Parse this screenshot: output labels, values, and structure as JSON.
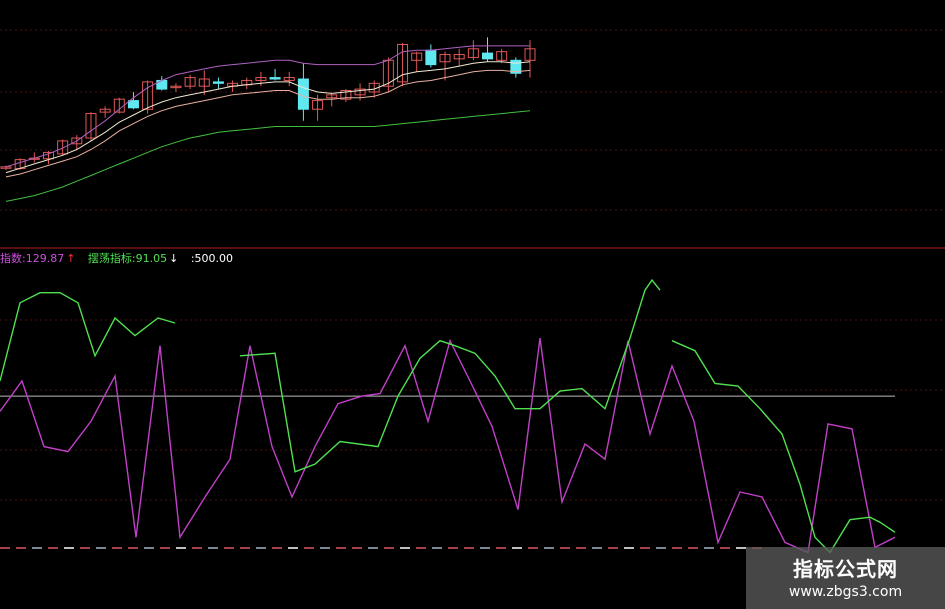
{
  "chart_data": [
    {
      "type": "candlestick",
      "title": "",
      "candles": [
        {
          "o": 8.5,
          "h": 9.4,
          "l": 7.8,
          "c": 9.0
        },
        {
          "o": 8.4,
          "h": 12.0,
          "l": 8.0,
          "c": 11.5
        },
        {
          "o": 11.6,
          "h": 14.0,
          "l": 10.5,
          "c": 12.0
        },
        {
          "o": 11.8,
          "h": 14.5,
          "l": 10.0,
          "c": 14.0
        },
        {
          "o": 13.5,
          "h": 18.5,
          "l": 13.0,
          "c": 18.0
        },
        {
          "o": 17.0,
          "h": 20.0,
          "l": 15.0,
          "c": 19.0
        },
        {
          "o": 19.0,
          "h": 28.0,
          "l": 18.0,
          "c": 27.5
        },
        {
          "o": 28.0,
          "h": 30.0,
          "l": 26.0,
          "c": 29.0
        },
        {
          "o": 28.0,
          "h": 33.0,
          "l": 27.5,
          "c": 32.5
        },
        {
          "o": 32.0,
          "h": 35.0,
          "l": 29.0,
          "c": 29.5
        },
        {
          "o": 29.0,
          "h": 39.0,
          "l": 27.5,
          "c": 38.5
        },
        {
          "o": 39.0,
          "h": 40.5,
          "l": 35.5,
          "c": 36.0
        },
        {
          "o": 36.5,
          "h": 38.0,
          "l": 35.0,
          "c": 37.0
        },
        {
          "o": 37.0,
          "h": 41.0,
          "l": 36.0,
          "c": 40.0
        },
        {
          "o": 37.0,
          "h": 42.5,
          "l": 34.0,
          "c": 39.5
        },
        {
          "o": 38.5,
          "h": 40.0,
          "l": 36.0,
          "c": 38.0
        },
        {
          "o": 37.0,
          "h": 39.0,
          "l": 35.0,
          "c": 38.0
        },
        {
          "o": 37.5,
          "h": 40.0,
          "l": 36.0,
          "c": 39.0
        },
        {
          "o": 39.0,
          "h": 42.0,
          "l": 37.0,
          "c": 40.0
        },
        {
          "o": 40.0,
          "h": 43.0,
          "l": 39.0,
          "c": 39.5
        },
        {
          "o": 39.0,
          "h": 42.0,
          "l": 37.0,
          "c": 40.0
        },
        {
          "o": 39.5,
          "h": 45.0,
          "l": 25.0,
          "c": 29.0
        },
        {
          "o": 29.0,
          "h": 34.0,
          "l": 25.0,
          "c": 32.0
        },
        {
          "o": 33.0,
          "h": 34.5,
          "l": 30.0,
          "c": 34.0
        },
        {
          "o": 32.5,
          "h": 36.0,
          "l": 31.5,
          "c": 35.5
        },
        {
          "o": 34.0,
          "h": 38.0,
          "l": 32.0,
          "c": 36.0
        },
        {
          "o": 35.0,
          "h": 39.0,
          "l": 33.0,
          "c": 38.0
        },
        {
          "o": 37.0,
          "h": 47.0,
          "l": 35.0,
          "c": 46.0
        },
        {
          "o": 38.5,
          "h": 52.0,
          "l": 37.0,
          "c": 51.5
        },
        {
          "o": 46.0,
          "h": 49.0,
          "l": 42.0,
          "c": 48.5
        },
        {
          "o": 49.5,
          "h": 51.5,
          "l": 43.5,
          "c": 44.5
        },
        {
          "o": 45.5,
          "h": 49.0,
          "l": 39.0,
          "c": 48.0
        },
        {
          "o": 46.5,
          "h": 50.0,
          "l": 44.0,
          "c": 48.0
        },
        {
          "o": 47.0,
          "h": 53.0,
          "l": 46.0,
          "c": 50.0
        },
        {
          "o": 48.5,
          "h": 54.0,
          "l": 45.5,
          "c": 46.5
        },
        {
          "o": 46.0,
          "h": 50.0,
          "l": 45.0,
          "c": 49.0
        },
        {
          "o": 46.0,
          "h": 47.0,
          "l": 40.0,
          "c": 41.5
        },
        {
          "o": 46.0,
          "h": 53.0,
          "l": 40.0,
          "c": 50.0
        }
      ],
      "ma_fast": [
        7.0,
        8.5,
        10.0,
        11.5,
        13.0,
        15.0,
        18.0,
        21.0,
        24.5,
        27.0,
        29.5,
        31.5,
        33.0,
        34.0,
        35.0,
        36.0,
        37.0,
        37.5,
        38.0,
        38.5,
        38.5,
        36.5,
        35.0,
        34.5,
        35.0,
        35.5,
        36.0,
        38.0,
        41.0,
        42.0,
        42.5,
        43.0,
        44.0,
        45.0,
        45.5,
        45.5,
        45.0,
        45.5
      ],
      "ma_slow": [
        5.5,
        6.5,
        8.0,
        9.5,
        11.0,
        12.5,
        15.0,
        18.0,
        21.5,
        24.0,
        26.5,
        28.5,
        30.0,
        31.0,
        32.0,
        33.0,
        34.0,
        34.5,
        35.0,
        35.5,
        35.5,
        33.5,
        32.5,
        32.5,
        33.0,
        33.0,
        33.5,
        35.0,
        37.5,
        38.5,
        39.0,
        40.0,
        41.0,
        42.0,
        42.5,
        42.5,
        42.0,
        42.5
      ],
      "ma_upper": [
        9.0,
        10.5,
        12.0,
        13.5,
        15.5,
        18.0,
        21.5,
        25.0,
        29.0,
        33.0,
        36.5,
        39.0,
        41.0,
        42.0,
        43.0,
        44.0,
        44.5,
        45.0,
        45.5,
        46.0,
        46.0,
        45.0,
        44.5,
        44.5,
        44.5,
        44.5,
        44.5,
        46.0,
        49.0,
        49.5,
        49.5,
        50.0,
        50.5,
        51.0,
        51.0,
        51.0,
        51.0,
        51.0
      ],
      "ma_lower": [
        -3.0,
        -2.0,
        -1.0,
        0.5,
        2.0,
        4.0,
        6.0,
        8.0,
        10.0,
        12.0,
        14.0,
        16.0,
        17.5,
        19.0,
        20.0,
        21.0,
        21.5,
        22.0,
        22.5,
        23.0,
        23.0,
        23.0,
        23.0,
        23.0,
        23.0,
        23.0,
        23.0,
        23.5,
        24.0,
        24.5,
        25.0,
        25.5,
        26.0,
        26.5,
        27.0,
        27.5,
        28.0,
        28.5
      ],
      "ylim": [
        -6,
        60
      ]
    },
    {
      "type": "line",
      "legend": [
        {
          "text": "指数:129.87",
          "arrow": "↑",
          "color": "#d04ee0",
          "arrow_color": "#ff3030"
        },
        {
          "text": "摆荡指标:91.05",
          "arrow": "↓",
          "color": "#50e050",
          "arrow_color": "#ffffff"
        },
        {
          "text": ":500.00",
          "arrow": "",
          "color": "#ffffff",
          "arrow_color": "#ffffff"
        }
      ],
      "series": [
        {
          "color": "#c040c8",
          "x": [
            0,
            22,
            44,
            68,
            91,
            115,
            136,
            160,
            180,
            205,
            230,
            250,
            272,
            292,
            315,
            338,
            362,
            380,
            405,
            428,
            450,
            470,
            492,
            518,
            540,
            562,
            585,
            605,
            628,
            650,
            672,
            694,
            718,
            740,
            762,
            785,
            808,
            828,
            852,
            875,
            895
          ],
          "y": [
            -60,
            60,
            -200,
            -220,
            -100,
            80,
            -560,
            200,
            -560,
            -400,
            -250,
            200,
            -200,
            -400,
            -200,
            -30,
            0,
            10,
            200,
            -100,
            220,
            60,
            -120,
            -450,
            230,
            -420,
            -190,
            -250,
            220,
            -150,
            120,
            -100,
            -580,
            -380,
            -400,
            -580,
            -620,
            -110,
            -130,
            -600,
            -560
          ]
        },
        {
          "color": "#50e050",
          "x": [
            0,
            20,
            40,
            60,
            78,
            95,
            115,
            135,
            158,
            175
          ],
          "y": [
            60,
            370,
            410,
            410,
            370,
            160,
            310,
            240,
            310,
            290
          ]
        },
        {
          "color": "#50e050",
          "x": [
            240,
            275,
            295,
            315,
            340,
            378,
            398,
            420,
            440,
            455,
            475,
            495,
            515,
            540,
            560,
            582,
            605,
            630,
            645,
            652,
            660
          ],
          "y": [
            160,
            170,
            -300,
            -270,
            -180,
            -200,
            0,
            150,
            220,
            200,
            170,
            80,
            -50,
            -50,
            20,
            30,
            -50,
            230,
            420,
            460,
            420
          ]
        },
        {
          "color": "#50e050",
          "x": [
            672,
            695,
            715,
            738,
            760,
            782,
            800,
            815,
            830,
            850,
            870,
            880,
            895
          ],
          "y": [
            220,
            180,
            50,
            40,
            -50,
            -150,
            -350,
            -560,
            -620,
            -490,
            -480,
            -500,
            -540
          ]
        }
      ],
      "hline": 0,
      "ylim": [
        -630,
        520
      ]
    }
  ],
  "watermark": {
    "title": "指标公式网",
    "url": "www.zbgs3.com"
  }
}
